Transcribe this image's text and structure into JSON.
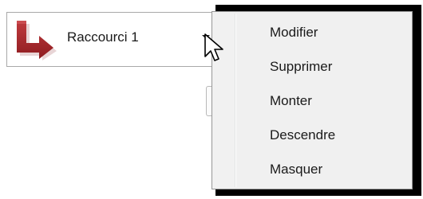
{
  "shortcut": {
    "label": "Raccourci 1",
    "icon": "arrow-turn-right-icon",
    "icon_color": "#a6262a"
  },
  "context_menu": {
    "items": [
      {
        "label": "Modifier"
      },
      {
        "label": "Supprimer"
      },
      {
        "label": "Monter"
      },
      {
        "label": "Descendre"
      },
      {
        "label": "Masquer"
      }
    ]
  },
  "cursor": {
    "icon": "mouse-pointer-icon"
  }
}
